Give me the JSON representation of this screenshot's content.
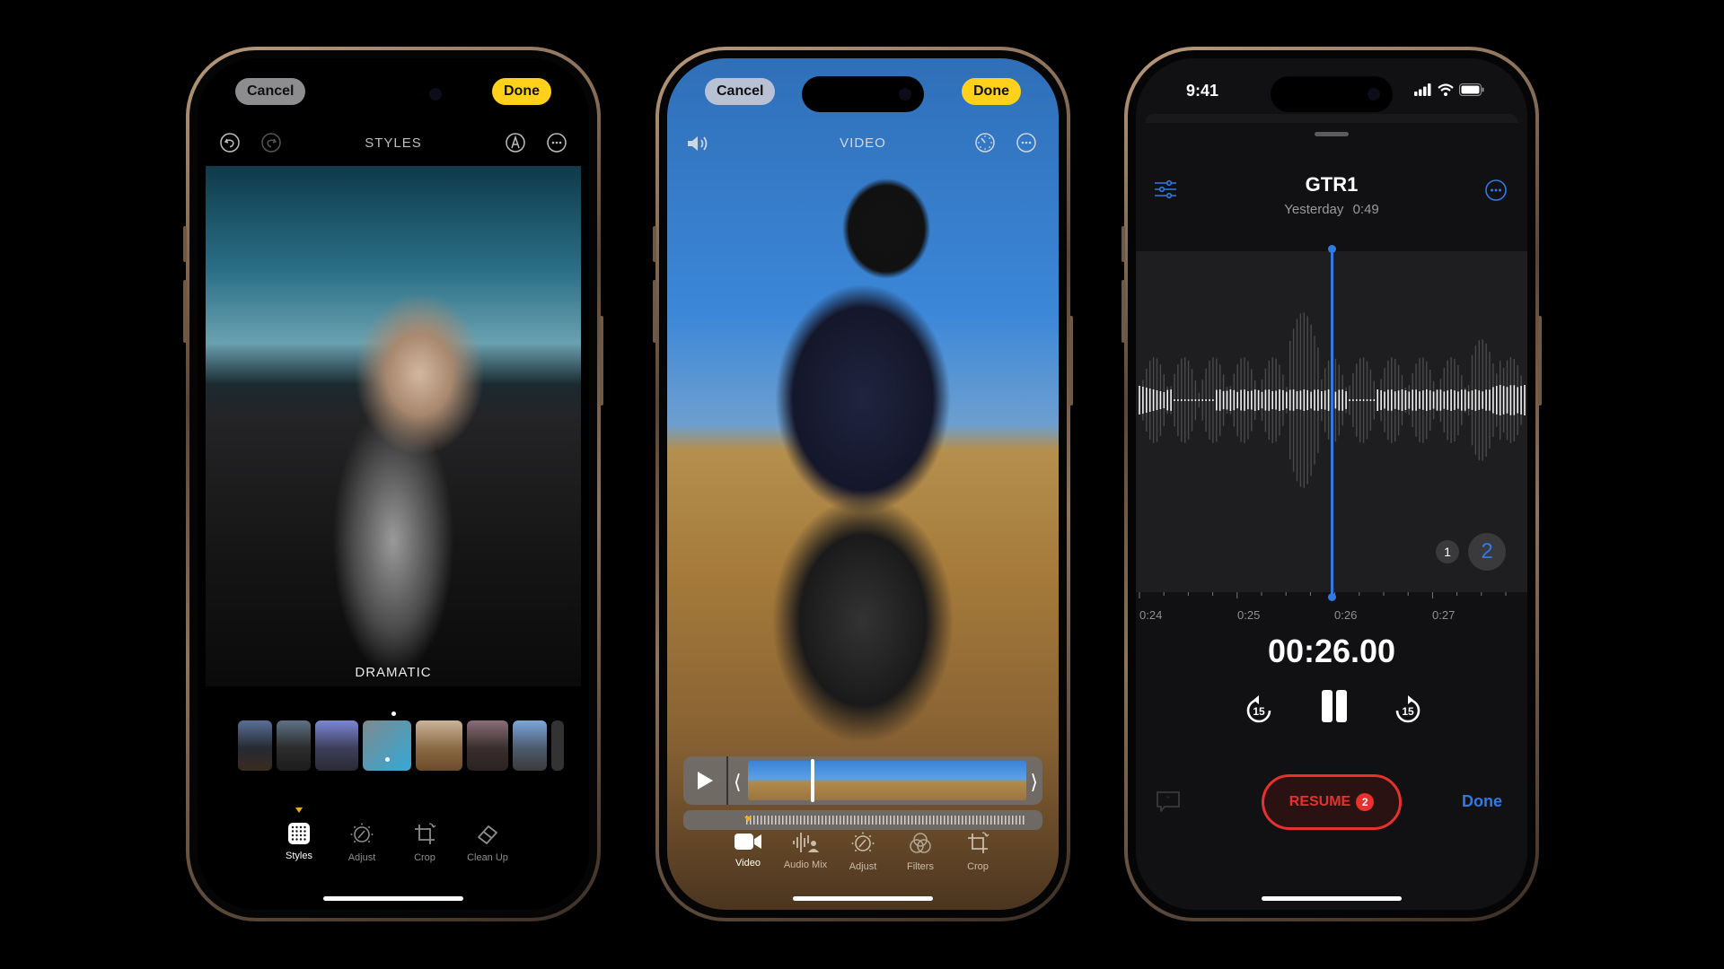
{
  "phones": [
    {
      "app": "Photos Styles editor",
      "cancel_label": "Cancel",
      "done_label": "Done",
      "title": "STYLES",
      "top_icons": [
        "undo-icon",
        "redo-icon",
        "markup-icon",
        "more-icon"
      ],
      "style_name": "DRAMATIC",
      "style_thumbnails_count": 8,
      "selected_thumbnail_index": 3,
      "tools": [
        {
          "label": "Styles",
          "icon": "styles-grid-icon",
          "active": true
        },
        {
          "label": "Adjust",
          "icon": "adjust-dial-icon",
          "active": false
        },
        {
          "label": "Crop",
          "icon": "crop-icon",
          "active": false
        },
        {
          "label": "Clean Up",
          "icon": "eraser-icon",
          "active": false
        }
      ]
    },
    {
      "app": "Photos Video editor",
      "cancel_label": "Cancel",
      "done_label": "Done",
      "title": "VIDEO",
      "top_icons": [
        "speaker-icon",
        "speed-icon",
        "more-icon"
      ],
      "tools": [
        {
          "label": "Video",
          "icon": "video-camera-icon",
          "active": true
        },
        {
          "label": "Audio Mix",
          "icon": "audio-mix-icon",
          "active": false
        },
        {
          "label": "Adjust",
          "icon": "adjust-dial-icon",
          "active": false
        },
        {
          "label": "Filters",
          "icon": "filters-icon",
          "active": false
        },
        {
          "label": "Crop",
          "icon": "crop-icon",
          "active": false
        }
      ]
    },
    {
      "app": "Voice Memos",
      "status_time": "9:41",
      "recording_title": "GTR1",
      "recording_date": "Yesterday",
      "recording_length": "0:49",
      "layer_options": [
        "1",
        "2"
      ],
      "selected_layer": "2",
      "timeline_labels": [
        "0:24",
        "0:25",
        "0:26",
        "0:27"
      ],
      "playhead_time": "00:26.00",
      "skip_back_seconds": "15",
      "skip_forward_seconds": "15",
      "resume_label": "RESUME",
      "resume_badge": "2",
      "done_label": "Done",
      "colors": {
        "accent": "#2f7ae5",
        "record": "#e5322d"
      }
    }
  ],
  "colors": {
    "done_yellow": "#ffd11a",
    "active_caret": "#f5a623"
  }
}
